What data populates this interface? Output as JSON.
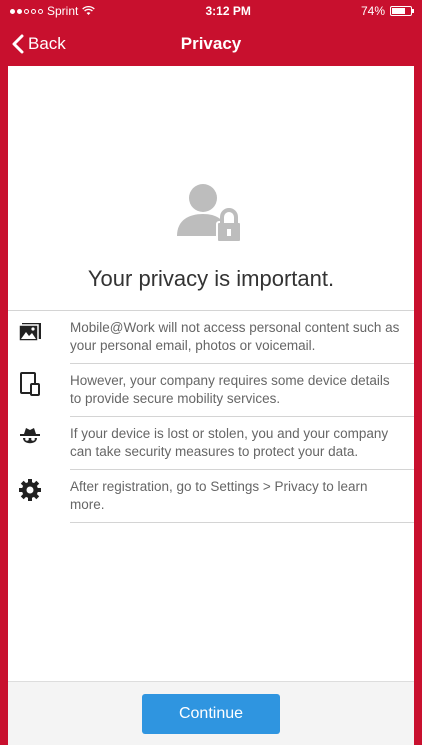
{
  "status_bar": {
    "carrier": "Sprint",
    "time": "3:12 PM",
    "battery": "74%",
    "battery_level": 0.74
  },
  "nav": {
    "back_label": "Back",
    "title": "Privacy"
  },
  "main": {
    "heading": "Your privacy is important.",
    "items": [
      {
        "icon": "photo-icon",
        "text": "Mobile@Work will not access personal content such as your personal email, photos or voicemail."
      },
      {
        "icon": "devices-icon",
        "text": "However, your company requires some device details to provide secure mobility services."
      },
      {
        "icon": "incognito-icon",
        "text": "If your device is lost or stolen, you and your company can take security measures to protect your data."
      },
      {
        "icon": "gear-icon",
        "text": "After registration, go to Settings > Privacy to learn more."
      }
    ]
  },
  "footer": {
    "continue_label": "Continue"
  },
  "colors": {
    "brand": "#c8102e",
    "button": "#2f95e0"
  }
}
